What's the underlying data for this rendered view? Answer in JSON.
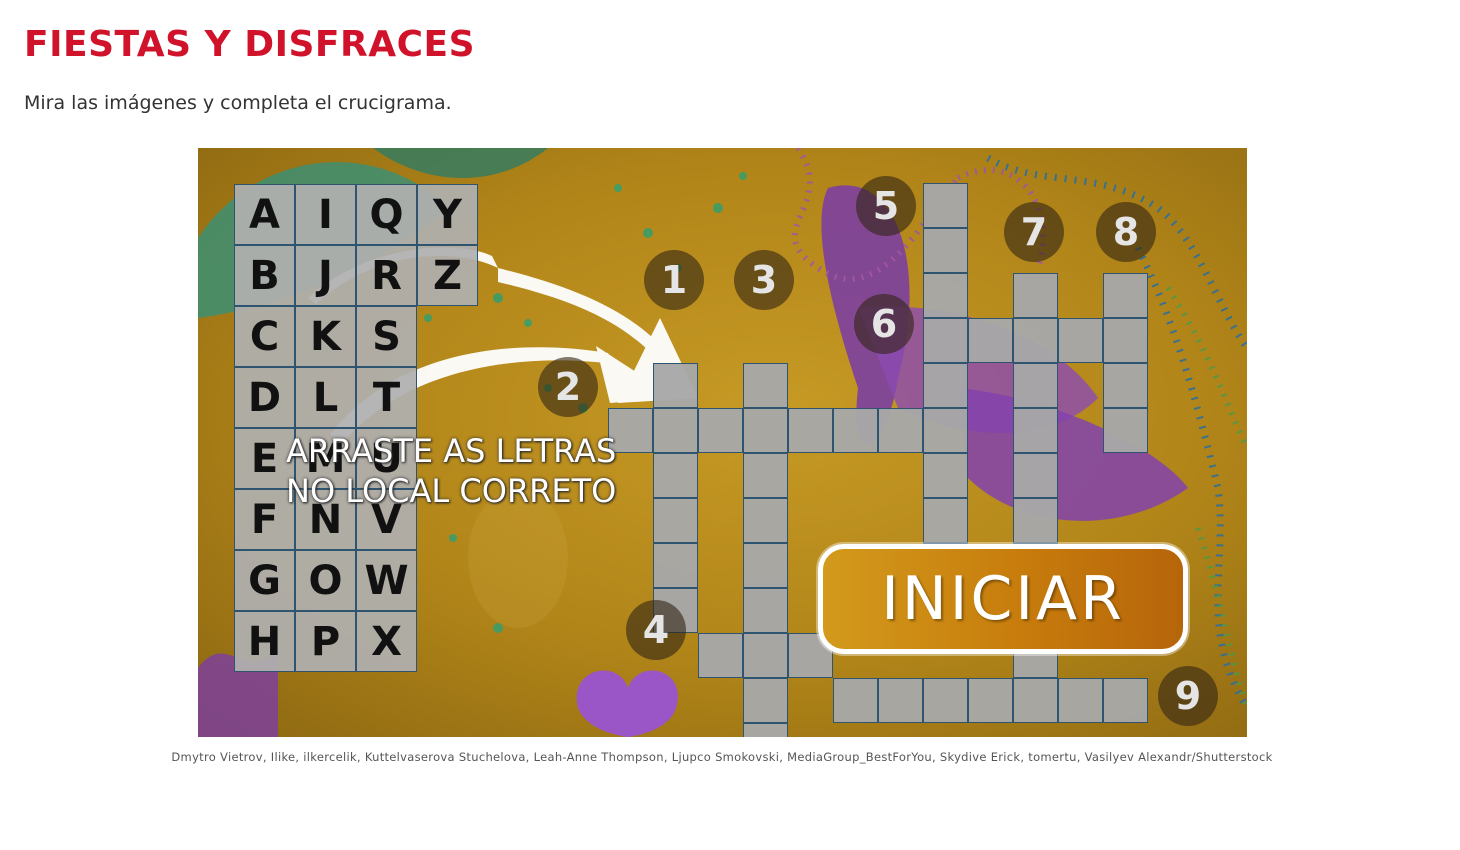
{
  "page": {
    "title": "FIESTAS Y DISFRACES",
    "instruction": "Mira las imágenes y completa el crucigrama.",
    "credits": "Dmytro Vietrov, Ilike, ilkercelik, Kuttelvaserova Stuchelova, Leah-Anne Thompson, Ljupco Smokovski, MediaGroup_BestForYou, Skydive Erick, tomertu, Vasilyev Alexandr/Shutterstock"
  },
  "colors": {
    "title": "#d0122b",
    "cell": "#a8a8a8",
    "cell_border": "#2e5470",
    "button": "#c77c0c"
  },
  "game": {
    "letters": [
      "A",
      "I",
      "Q",
      "Y",
      "B",
      "J",
      "R",
      "Z",
      "C",
      "K",
      "S",
      "",
      "D",
      "L",
      "T",
      "",
      "E",
      "M",
      "U",
      "",
      "F",
      "N",
      "V",
      "",
      "G",
      "O",
      "W",
      "",
      "H",
      "P",
      "X",
      ""
    ],
    "hint_text": "ARRASTE AS LETRAS\nNO LOCAL CORRETO",
    "start_label": "INICIAR",
    "clue_numbers": [
      "1",
      "2",
      "3",
      "4",
      "5",
      "6",
      "7",
      "8",
      "9"
    ]
  }
}
